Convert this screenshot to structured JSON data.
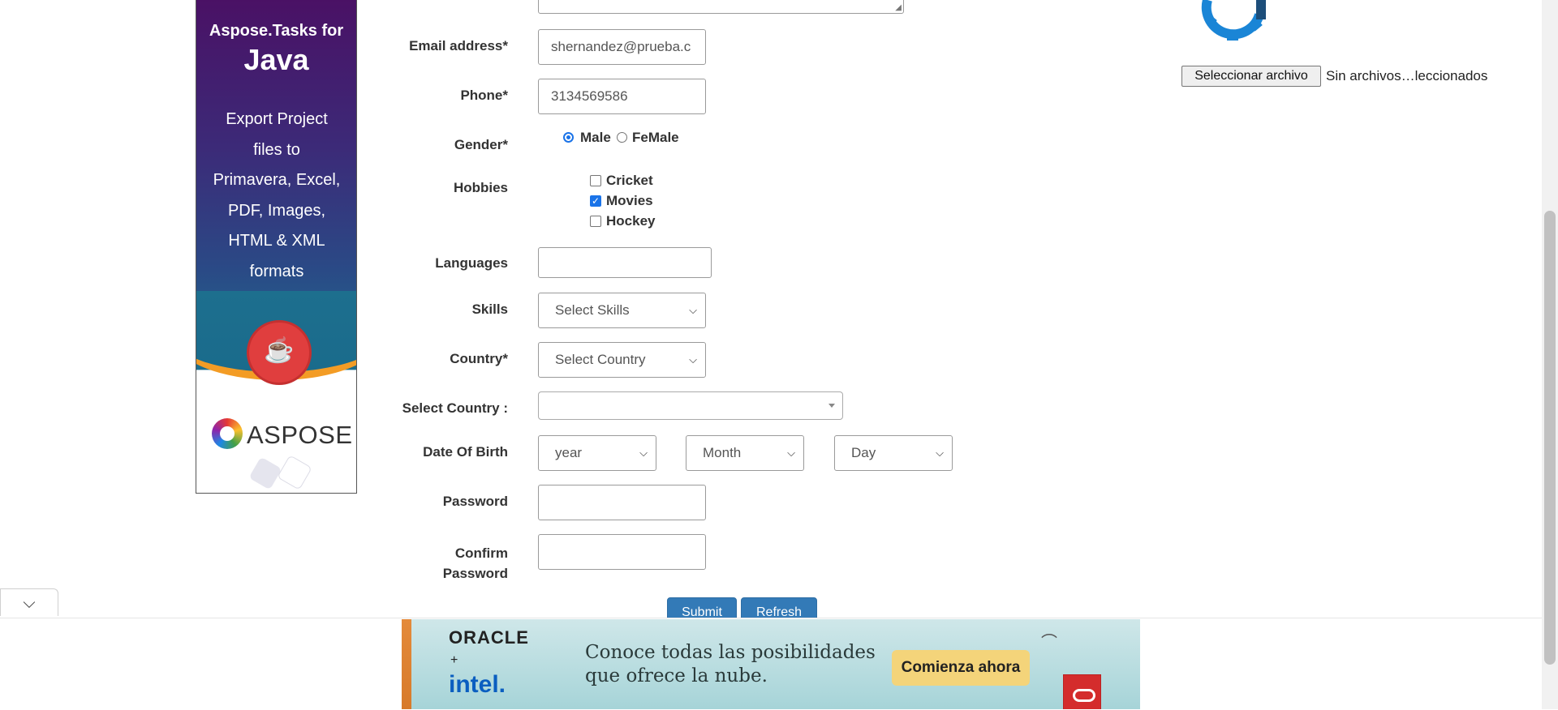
{
  "ad_left": {
    "brand": "Aspose.Tasks for",
    "product": "Java",
    "lines": [
      "Export Project",
      "files to",
      "Primavera, Excel,",
      "PDF, Images,",
      "HTML & XML",
      "formats"
    ],
    "logo": "ASPOSE"
  },
  "form": {
    "email": {
      "label": "Email address*",
      "value": "shernandez@prueba.c"
    },
    "phone": {
      "label": "Phone*",
      "value": "3134569586"
    },
    "gender": {
      "label": "Gender*",
      "options": [
        "Male",
        "FeMale"
      ],
      "selected": "Male"
    },
    "hobbies": {
      "label": "Hobbies",
      "options": [
        {
          "label": "Cricket",
          "checked": false
        },
        {
          "label": "Movies",
          "checked": true
        },
        {
          "label": "Hockey",
          "checked": false
        }
      ]
    },
    "languages": {
      "label": "Languages",
      "value": ""
    },
    "skills": {
      "label": "Skills",
      "value": "Select Skills"
    },
    "country": {
      "label": "Country*",
      "value": "Select Country"
    },
    "select_country": {
      "label": "Select Country :",
      "value": ""
    },
    "dob": {
      "label": "Date Of Birth",
      "year": "year",
      "month": "Month",
      "day": "Day"
    },
    "password": {
      "label": "Password",
      "value": ""
    },
    "confirm_password": {
      "label_line1": "Confirm",
      "label_line2": "Password",
      "value": ""
    },
    "submit_label": "Submit",
    "refresh_label": "Refresh"
  },
  "file_upload": {
    "button_label": "Seleccionar archivo",
    "status": "Sin archivos…leccionados"
  },
  "ad_bottom": {
    "brand1": "ORACLE",
    "plus": "+",
    "brand2": "intel.",
    "message_line1": "Conoce todas las posibilidades",
    "message_line2": "que ofrece la nube.",
    "cta": "Comienza ahora"
  },
  "icons": {
    "collapse": "chevron-down-icon",
    "gear": "gear-icon",
    "select_arrow": "chevron-down-icon"
  },
  "colors": {
    "primary_button": "#337ab7",
    "radio_checkbox": "#1a73e8",
    "gear": "#1a85d6"
  }
}
